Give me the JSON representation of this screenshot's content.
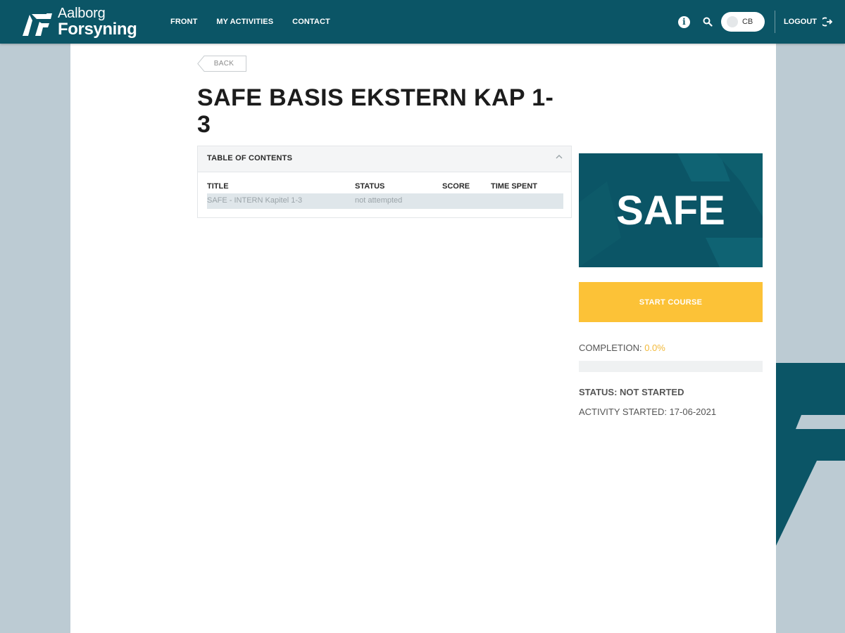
{
  "brand": {
    "line1": "Aalborg",
    "line2": "Forsyning",
    "colors": {
      "primary": "#0b5566",
      "accent": "#fcc237",
      "background": "#bccbd3"
    }
  },
  "nav": {
    "items": [
      {
        "label": "FRONT"
      },
      {
        "label": "MY ACTIVITIES"
      },
      {
        "label": "CONTACT"
      }
    ]
  },
  "toolbar": {
    "info_icon": "info-icon",
    "search_icon": "search-icon",
    "user_initials": "CB",
    "logout_label": "LOGOUT",
    "logout_icon": "logout-icon"
  },
  "page": {
    "back_label": "BACK",
    "title": "SAFE BASIS EKSTERN KAP 1-3"
  },
  "toc": {
    "header": "TABLE OF CONTENTS",
    "columns": [
      "TITLE",
      "STATUS",
      "SCORE",
      "TIME SPENT"
    ],
    "rows": [
      {
        "title": "SAFE - INTERN Kapitel 1-3",
        "status": "not attempted",
        "score": "",
        "time_spent": ""
      }
    ]
  },
  "sidebar": {
    "banner_text": "SAFE",
    "start_label": "START COURSE",
    "completion_label": "COMPLETION:",
    "completion_value": "0.0%",
    "completion_fraction": 0.0,
    "status_text": "STATUS: NOT STARTED",
    "activity_started": "ACTIVITY STARTED: 17-06-2021"
  }
}
